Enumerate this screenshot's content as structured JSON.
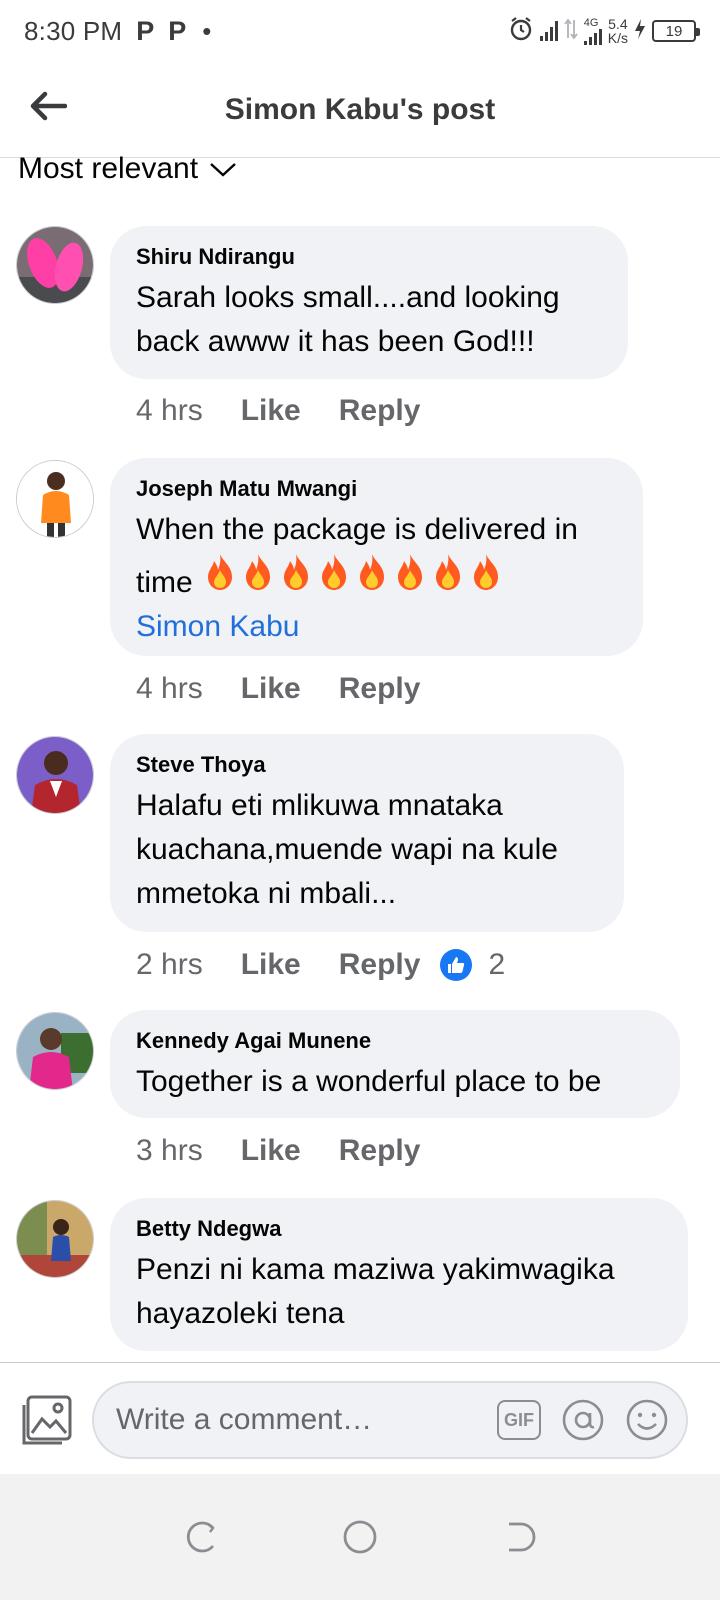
{
  "status_bar": {
    "time": "8:30 PM",
    "notif_icons": [
      "P",
      "P"
    ],
    "dot": "•",
    "network_label": "4G",
    "speed_value": "5.4",
    "speed_unit": "K/s",
    "battery": "19"
  },
  "header": {
    "title": "Simon Kabu's post"
  },
  "sort": {
    "label": "Most relevant"
  },
  "comments": [
    {
      "author": "Shiru Ndirangu",
      "text": "Sarah looks small....and looking back awww it has been God!!!",
      "time": "4 hrs",
      "like_label": "Like",
      "reply_label": "Reply"
    },
    {
      "author": "Joseph Matu Mwangi",
      "text": "When the package is delivered in time",
      "fire_count": 8,
      "mention": "Simon Kabu",
      "time": "4 hrs",
      "like_label": "Like",
      "reply_label": "Reply"
    },
    {
      "author": "Steve Thoya",
      "text": "Halafu eti mlikuwa mnataka kuachana,muende wapi na kule mmetoka ni mbali...",
      "time": "2 hrs",
      "like_label": "Like",
      "reply_label": "Reply",
      "reaction_count": "2"
    },
    {
      "author": "Kennedy Agai Munene",
      "text": "Together is a wonderful place to be",
      "time": "3 hrs",
      "like_label": "Like",
      "reply_label": "Reply"
    },
    {
      "author": "Betty Ndegwa",
      "text": "Penzi ni kama maziwa yakimwagika hayazoleki tena"
    }
  ],
  "composer": {
    "placeholder": "Write a comment…",
    "gif_label": "GIF"
  },
  "colors": {
    "bubble": "#f0f2f5",
    "mention": "#216fdb",
    "like_reaction": "#1877f2",
    "meta_text": "#65676b"
  }
}
